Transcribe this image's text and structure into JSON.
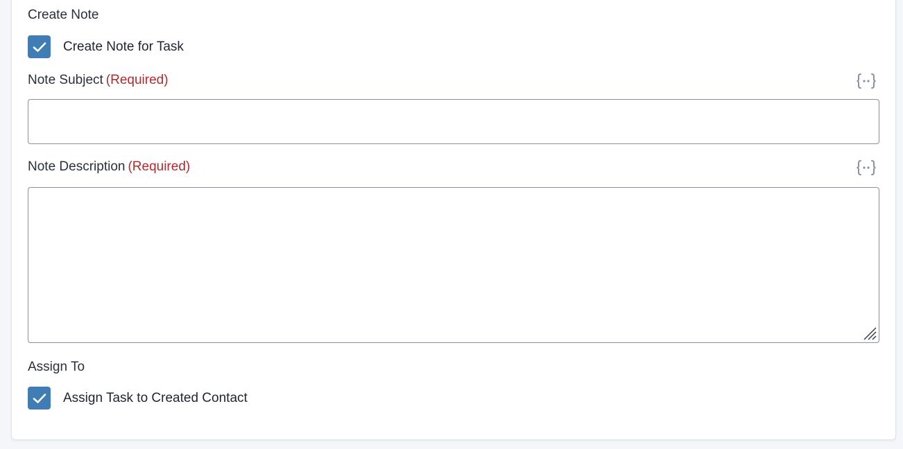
{
  "create_note": {
    "section_title": "Create Note",
    "checkbox": {
      "label": "Create Note for Task",
      "checked": true
    }
  },
  "note_subject": {
    "label": "Note Subject",
    "required_text": "(Required)",
    "value": "",
    "variable_icon": "curly-braces-icon"
  },
  "note_description": {
    "label": "Note Description",
    "required_text": "(Required)",
    "value": "",
    "variable_icon": "curly-braces-icon"
  },
  "assign_to": {
    "section_title": "Assign To",
    "checkbox": {
      "label": "Assign Task to Created Contact",
      "checked": true
    }
  },
  "colors": {
    "checkbox_fill": "#3f7db4",
    "required_text": "#b22a2a",
    "icon_gray": "#8a90a6"
  }
}
